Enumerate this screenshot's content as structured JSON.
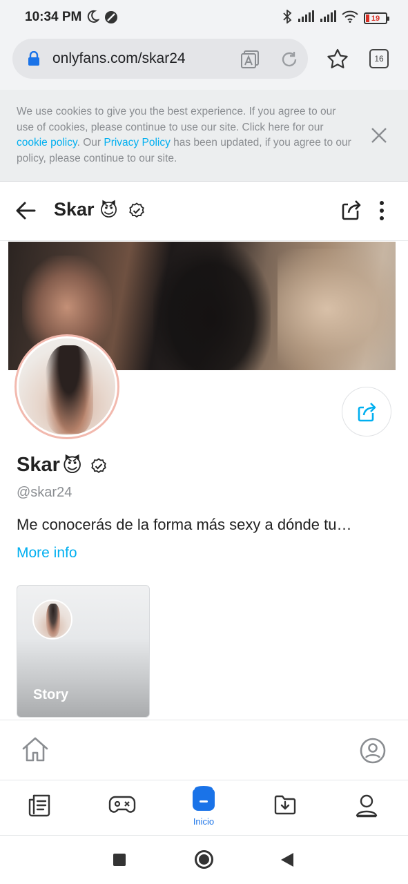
{
  "status_bar": {
    "time": "10:34 PM",
    "battery": "19",
    "icons": [
      "moon-icon",
      "dnd-icon",
      "bluetooth-icon",
      "signal-icon",
      "signal-icon",
      "wifi-icon",
      "battery-icon"
    ]
  },
  "browser": {
    "url": "onlyfans.com/skar24",
    "tab_count": "16"
  },
  "cookie_banner": {
    "text_1": "We use cookies to give you the best experience. If you agree to our use of cookies, please continue to use our site. Click here for our ",
    "cookie_link": "cookie policy",
    "text_2": ". Our ",
    "privacy_link": "Privacy Policy",
    "text_3": " has been updated, if you agree to our policy, please continue to our site."
  },
  "header": {
    "title": "Skar",
    "emoji": "😈"
  },
  "profile": {
    "name": "Skar",
    "emoji": "😈",
    "username": "@skar24",
    "bio": "Me conocerás de la forma más sexy a dónde tu…",
    "more_info": "More info"
  },
  "story": {
    "label": "Story"
  },
  "browser_nav": {
    "inicio_label": "Inicio"
  },
  "colors": {
    "accent": "#00aff0",
    "chrome_blue": "#1a73e8",
    "avatar_ring": "#f2b9ae",
    "muted_text": "#8a8d91"
  }
}
